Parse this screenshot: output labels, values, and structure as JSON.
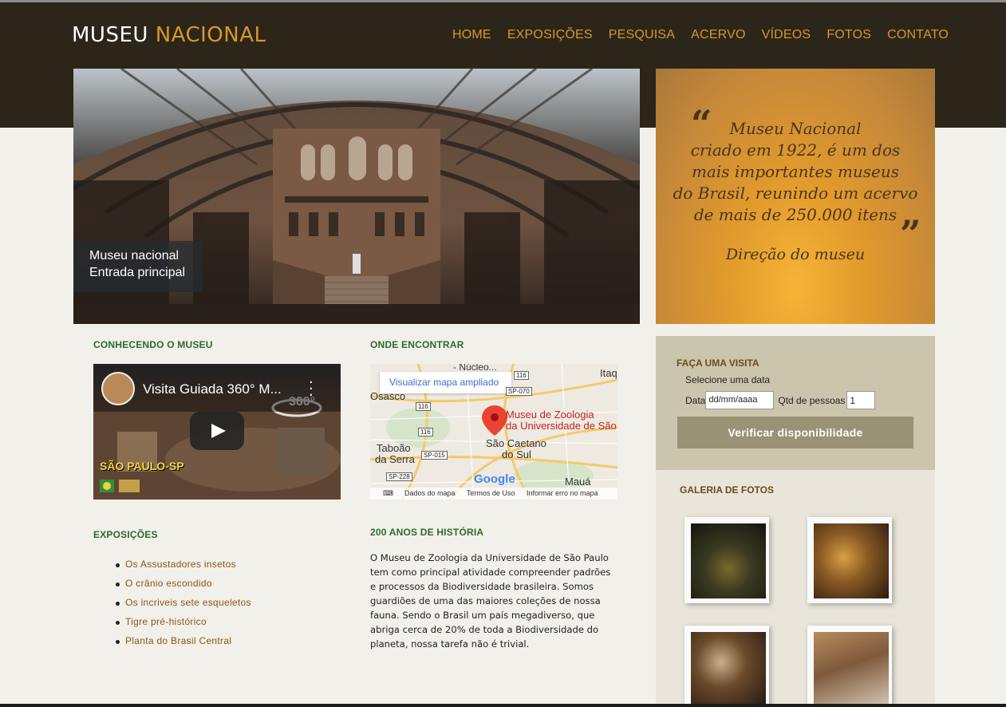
{
  "header": {
    "logo_white": "MUSEU",
    "logo_gold": "NACIONAL",
    "nav": [
      "HOME",
      "EXPOSIÇÕES",
      "PESQUISA",
      "ACERVO",
      "VÍDEOS",
      "FOTOS",
      "CONTATO"
    ]
  },
  "hero": {
    "caption_line1": "Museu nacional",
    "caption_line2": "Entrada principal"
  },
  "quote": {
    "lines": [
      "Museu Nacional",
      "criado em 1922, é um dos",
      "mais importantes museus",
      "do Brasil, reunindo um acervo",
      "de mais de 250.000 itens"
    ],
    "author": "Direção do museu"
  },
  "conhecendo": {
    "title": "CONHECENDO O MUSEU",
    "video_title": "Visita Guiada 360° M...",
    "video_watermark": "SÃO PAULO-SP"
  },
  "onde": {
    "title": "ONDE ENCONTRAR",
    "map_link": "Visualizar mapa ampliado",
    "place_line1": "Museu de Zoologia",
    "place_line2": "da Universidade de São",
    "cities": [
      "Osasco",
      "Taboão",
      "da Serra",
      "São Caetano",
      "do Sul",
      "Mauá",
      "Itaq",
      "- Núcleo..."
    ],
    "roads": [
      "116",
      "SP-070",
      "116",
      "116",
      "SP-015",
      "SP-228"
    ],
    "google": "Google",
    "footer": [
      "Dados do mapa",
      "Termos de Uso",
      "Informar erro no mapa"
    ]
  },
  "exposicoes": {
    "title": "EXPOSIÇÕES",
    "items": [
      "Os Assustadores insetos",
      "O crânio escondido",
      "Os incriveis sete esqueletos",
      "Tigre pré-histórico",
      "Planta do Brasil Central"
    ]
  },
  "historia": {
    "title": "200 ANOS DE HISTÓRIA",
    "text": "O Museu de Zoologia da Universidade de São Paulo tem como principal atividade compreender padrões e processos da Biodiversidade brasileira. Somos guardiões de uma das maiores coleções de nossa fauna. Sendo o Brasil um país megadiverso, que abriga cerca de 20% de toda a Biodiversidade do planeta, nossa tarefa não é trivial."
  },
  "visita": {
    "title": "FAÇA UMA VISITA",
    "subtitle": "Selecione uma data",
    "date_label": "Data",
    "date_placeholder": "dd/mm/aaaa",
    "qty_label": "Qtd de pessoas",
    "qty_value": "1",
    "button": "Verificar disponibilidade"
  },
  "galeria": {
    "title": "GALERIA DE FOTOS"
  },
  "colors": {
    "header_bg": "#2b2619",
    "accent_gold": "#d7972a",
    "section_green": "#2e6a2a",
    "link_brown": "#8a5618"
  }
}
